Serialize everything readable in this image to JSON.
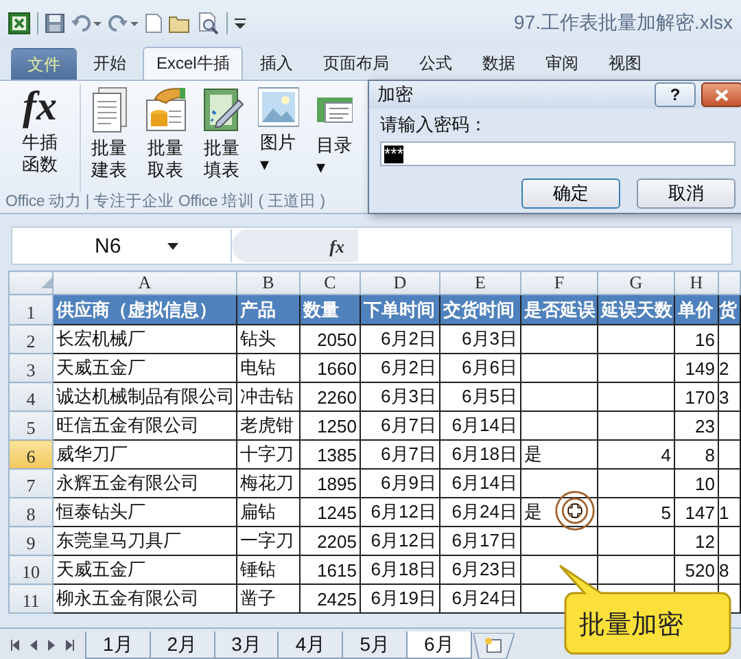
{
  "window": {
    "title": "97.工作表批量加解密.xlsx"
  },
  "ribbon_tabs": [
    {
      "label": "文件",
      "kind": "file",
      "selected": false
    },
    {
      "label": "开始",
      "kind": "tab",
      "selected": false
    },
    {
      "label": "Excel牛插",
      "kind": "tab",
      "selected": true
    },
    {
      "label": "插入",
      "kind": "tab",
      "selected": false
    },
    {
      "label": "页面布局",
      "kind": "tab",
      "selected": false
    },
    {
      "label": "公式",
      "kind": "tab",
      "selected": false
    },
    {
      "label": "数据",
      "kind": "tab",
      "selected": false
    },
    {
      "label": "审阅",
      "kind": "tab",
      "selected": false
    },
    {
      "label": "视图",
      "kind": "tab",
      "selected": false
    }
  ],
  "ribbon_buttons": [
    {
      "kind": "function",
      "glyph": "fx",
      "lines": [
        "牛插",
        "函数"
      ]
    },
    {
      "kind": "document",
      "lines": [
        "批量",
        "建表"
      ]
    },
    {
      "kind": "database",
      "lines": [
        "批量",
        "取表"
      ]
    },
    {
      "kind": "fill",
      "lines": [
        "批量",
        "填表"
      ]
    },
    {
      "kind": "picture",
      "lines": [
        "图片",
        "▾"
      ]
    },
    {
      "kind": "contents",
      "lines": [
        "目录",
        "▾"
      ]
    }
  ],
  "ribbon_group_label": "Office 动力 | 专注于企业 Office 培训 ( 王道田 )",
  "formula_bar": {
    "name_box": "N6",
    "fx": "fx"
  },
  "columns": [
    {
      "letter": "A",
      "selected": false
    },
    {
      "letter": "B",
      "selected": false
    },
    {
      "letter": "C",
      "selected": false
    },
    {
      "letter": "D",
      "selected": false
    },
    {
      "letter": "E",
      "selected": false
    },
    {
      "letter": "F",
      "selected": false
    },
    {
      "letter": "G",
      "selected": false
    },
    {
      "letter": "H",
      "selected": false
    }
  ],
  "rows": [
    {
      "number": "1",
      "kind": "header",
      "selected": false,
      "cells": [
        "供应商（虚拟信息）",
        "产品",
        "数量",
        "下单时间",
        "交货时间",
        "是否延误",
        "延误天数",
        "单价",
        "货"
      ]
    },
    {
      "number": "2",
      "kind": "data",
      "selected": false,
      "cells": [
        "长宏机械厂",
        "钻头",
        "2050",
        "6月2日",
        "6月3日",
        "",
        "",
        "16",
        ""
      ]
    },
    {
      "number": "3",
      "kind": "data",
      "selected": false,
      "cells": [
        "天威五金厂",
        "电钻",
        "1660",
        "6月2日",
        "6月6日",
        "",
        "",
        "149",
        "2"
      ]
    },
    {
      "number": "4",
      "kind": "data",
      "selected": false,
      "cells": [
        "诚达机械制品有限公司",
        "冲击钻",
        "2260",
        "6月3日",
        "6月5日",
        "",
        "",
        "170",
        "3"
      ]
    },
    {
      "number": "5",
      "kind": "data",
      "selected": false,
      "cells": [
        "旺信五金有限公司",
        "老虎钳",
        "1250",
        "6月7日",
        "6月14日",
        "",
        "",
        "23",
        ""
      ]
    },
    {
      "number": "6",
      "kind": "data",
      "selected": true,
      "cells": [
        "威华刀厂",
        "十字刀",
        "1385",
        "6月7日",
        "6月18日",
        "是",
        "4",
        "8",
        ""
      ]
    },
    {
      "number": "7",
      "kind": "data",
      "selected": false,
      "cells": [
        "永辉五金有限公司",
        "梅花刀",
        "1895",
        "6月9日",
        "6月14日",
        "",
        "",
        "10",
        ""
      ]
    },
    {
      "number": "8",
      "kind": "data",
      "selected": false,
      "cells": [
        "恒泰钻头厂",
        "扁钻",
        "1245",
        "6月12日",
        "6月24日",
        "是",
        "5",
        "147",
        "1"
      ]
    },
    {
      "number": "9",
      "kind": "data",
      "selected": false,
      "cells": [
        "东莞皇马刀具厂",
        "一字刀",
        "2205",
        "6月12日",
        "6月17日",
        "",
        "",
        "12",
        ""
      ]
    },
    {
      "number": "10",
      "kind": "data",
      "selected": false,
      "cells": [
        "天威五金厂",
        "锤钻",
        "1615",
        "6月18日",
        "6月23日",
        "",
        "",
        "520",
        "8"
      ]
    },
    {
      "number": "11",
      "kind": "data",
      "selected": false,
      "cells": [
        "柳永五金有限公司",
        "凿子",
        "2425",
        "6月19日",
        "6月24日",
        "",
        "",
        "",
        ""
      ]
    }
  ],
  "sheet_tabs": [
    {
      "label": "1月",
      "selected": false
    },
    {
      "label": "2月",
      "selected": false
    },
    {
      "label": "3月",
      "selected": false
    },
    {
      "label": "4月",
      "selected": false
    },
    {
      "label": "5月",
      "selected": false
    },
    {
      "label": "6月",
      "selected": true
    }
  ],
  "dialog": {
    "title": "加密",
    "help": "?",
    "prompt": "请输入密码：",
    "password": "***",
    "buttons": [
      "确定",
      "取消"
    ]
  },
  "callout": "批量加密"
}
